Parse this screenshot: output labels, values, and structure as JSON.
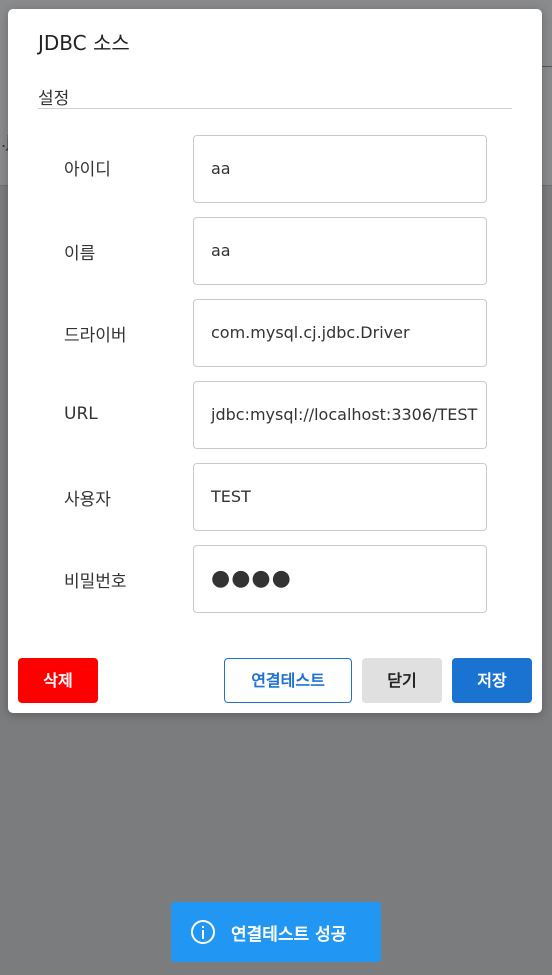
{
  "dialog": {
    "title": "JDBC 소스",
    "section": "설정"
  },
  "fields": [
    {
      "label": "아이디",
      "value": "aa"
    },
    {
      "label": "이름",
      "value": "aa"
    },
    {
      "label": "드라이버",
      "value": "com.mysql.cj.jdbc.Driver"
    },
    {
      "label": "URL",
      "value": "jdbc:mysql://localhost:3306/TEST"
    },
    {
      "label": "사용자",
      "value": "TEST"
    },
    {
      "label": "비밀번호",
      "value": "●●●●"
    }
  ],
  "buttons": {
    "delete": "삭제",
    "test": "연결테스트",
    "close": "닫기",
    "save": "저장"
  },
  "toast": {
    "message": "연결테스트 성공",
    "icon": "info-icon"
  },
  "colors": {
    "delete": "#ff0000",
    "primary": "#1a73d1",
    "toast": "#2196f3"
  }
}
